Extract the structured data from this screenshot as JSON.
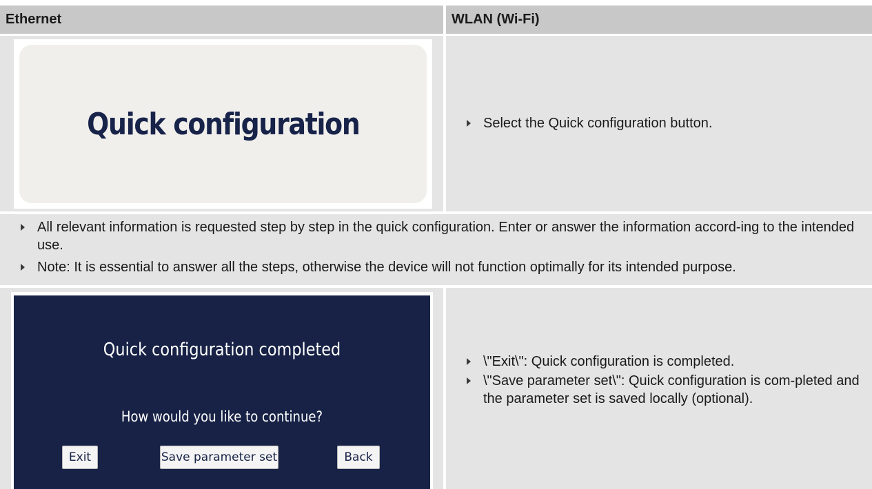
{
  "headers": {
    "ethernet": "Ethernet",
    "wlan": "WLAN (Wi-Fi)"
  },
  "row1": {
    "button_label": "Quick configuration",
    "instruction": "Select the Quick configuration button."
  },
  "row2": {
    "bullets": [
      "All relevant information is requested step by step in the quick configuration. Enter or answer the information accord-ing to the intended use.",
      "Note: It is essential to answer all the steps, otherwise the device will not function optimally for its intended purpose."
    ]
  },
  "row3": {
    "dialog": {
      "title": "Quick configuration completed",
      "question": "How would you like to continue?",
      "buttons": {
        "exit": "Exit",
        "save": "Save parameter set",
        "back": "Back"
      }
    },
    "bullets": [
      "\\\"Exit\\\": Quick configuration is completed.",
      "\\\"Save parameter set\\\": Quick configuration is com-pleted and the parameter set is saved locally (optional)."
    ]
  },
  "colors": {
    "header_bg": "#c8c8c9",
    "cell_bg": "#e4e4e5",
    "dialog_bg": "#172246",
    "quick_config_text": "#182349"
  }
}
